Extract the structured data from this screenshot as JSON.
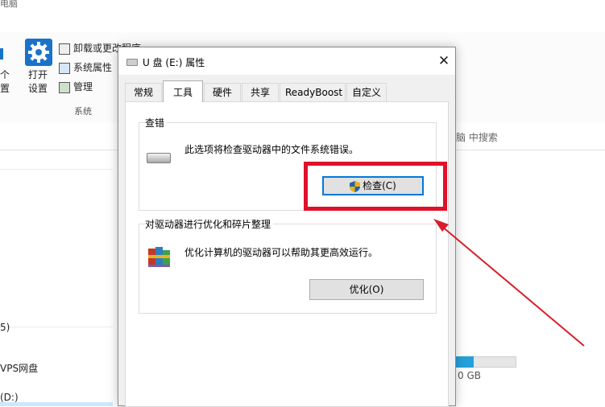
{
  "explorer": {
    "window_title_partial": "电脑",
    "ribbon": {
      "open_settings_label_line1": "打开",
      "open_settings_label_line2": "设置",
      "left_cut_label_line1": "个",
      "left_cut_label_line2": "置",
      "uninstall_label": "卸载或更改程序",
      "system_properties_label": "系统属性",
      "manage_label": "管理",
      "group_system_label": "系统"
    },
    "search_hint": "脑 中搜索",
    "left_nav": {
      "item_1": "5)",
      "item_2": "VPS网盘",
      "item_3": "(D:)"
    },
    "drive_free_text": "0 GB",
    "drive_usage_fraction": 0.29
  },
  "dialog": {
    "title": "U 盘 (E:) 属性",
    "close_glyph": "✕",
    "tabs": [
      {
        "label": "常规"
      },
      {
        "label": "工具"
      },
      {
        "label": "硬件"
      },
      {
        "label": "共享"
      },
      {
        "label": "ReadyBoost"
      },
      {
        "label": "自定义"
      }
    ],
    "active_tab_index": 1,
    "check_group": {
      "title": "查错",
      "description": "此选项将检查驱动器中的文件系统错误。",
      "button_label": "检查(C)"
    },
    "optimize_group": {
      "title": "对驱动器进行优化和碎片整理",
      "description": "优化计算机的驱动器可以帮助其更高效运行。",
      "button_label": "优化(O)"
    }
  },
  "colors": {
    "annotation_red": "#e0102a",
    "accent_blue": "#0078d7",
    "drive_bar_blue": "#26a0da"
  }
}
